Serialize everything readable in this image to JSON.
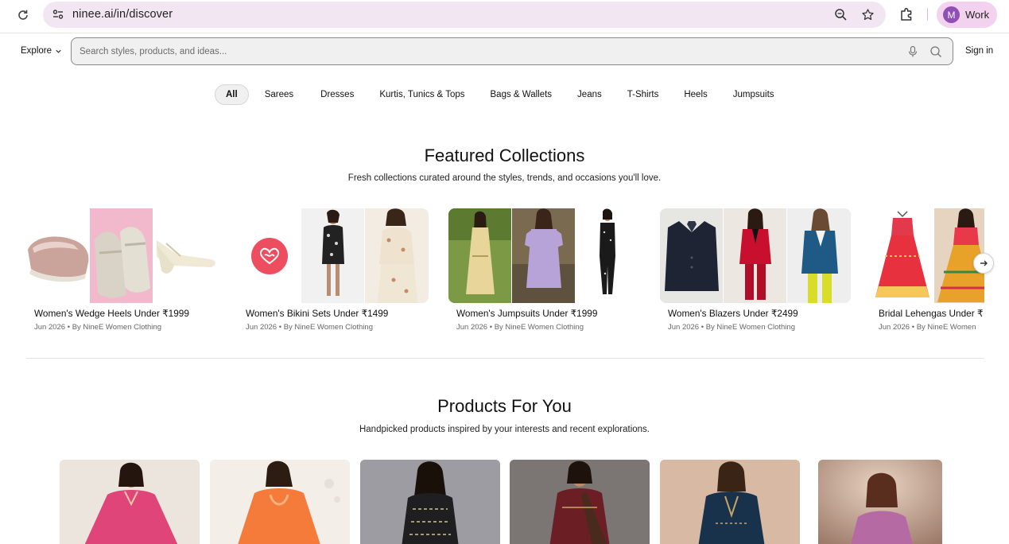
{
  "browser": {
    "url": "ninee.ai/in/discover",
    "profile_initial": "M",
    "profile_label": "Work"
  },
  "header": {
    "explore_label": "Explore",
    "search_placeholder": "Search styles, products, and ideas...",
    "signin_label": "Sign in"
  },
  "categories": [
    {
      "label": "All",
      "active": true
    },
    {
      "label": "Sarees"
    },
    {
      "label": "Dresses"
    },
    {
      "label": "Kurtis, Tunics & Tops"
    },
    {
      "label": "Bags & Wallets"
    },
    {
      "label": "Jeans"
    },
    {
      "label": "T-Shirts"
    },
    {
      "label": "Heels"
    },
    {
      "label": "Jumpsuits"
    }
  ],
  "featured": {
    "title": "Featured Collections",
    "subtitle": "Fresh collections curated around the styles, trends, and occasions you'll love.",
    "collections": [
      {
        "title": "Women's Wedge Heels Under ₹1999",
        "meta": "Jun 2026 • By NineE Women Clothing"
      },
      {
        "title": "Women's Bikini Sets Under ₹1499",
        "meta": "Jun 2026 • By NineE Women Clothing"
      },
      {
        "title": "Women's Jumpsuits Under ₹1999",
        "meta": "Jun 2026 • By NineE Women Clothing"
      },
      {
        "title": "Women's Blazers Under ₹2499",
        "meta": "Jun 2026 • By NineE Women Clothing"
      },
      {
        "title": "Bridal Lehengas Under ₹",
        "meta": "Jun 2026 • By NineE Women"
      }
    ]
  },
  "products": {
    "title": "Products For You",
    "subtitle": "Handpicked products inspired by your interests and recent explorations."
  },
  "icons": {
    "reload": "reload-icon",
    "site_info": "site-info-icon",
    "zoom": "zoom-icon",
    "bookmark": "star-icon",
    "extensions": "puzzle-icon",
    "mic": "mic-icon",
    "search": "search-icon",
    "next": "arrow-right-icon",
    "brand": "heart-infinity-logo"
  },
  "colors": {
    "omnibox_bg": "#f3e6f3",
    "profile_bg": "#f3d2f0",
    "avatar_bg": "#8f4fb4",
    "brand_red": "#ee4d5f"
  }
}
